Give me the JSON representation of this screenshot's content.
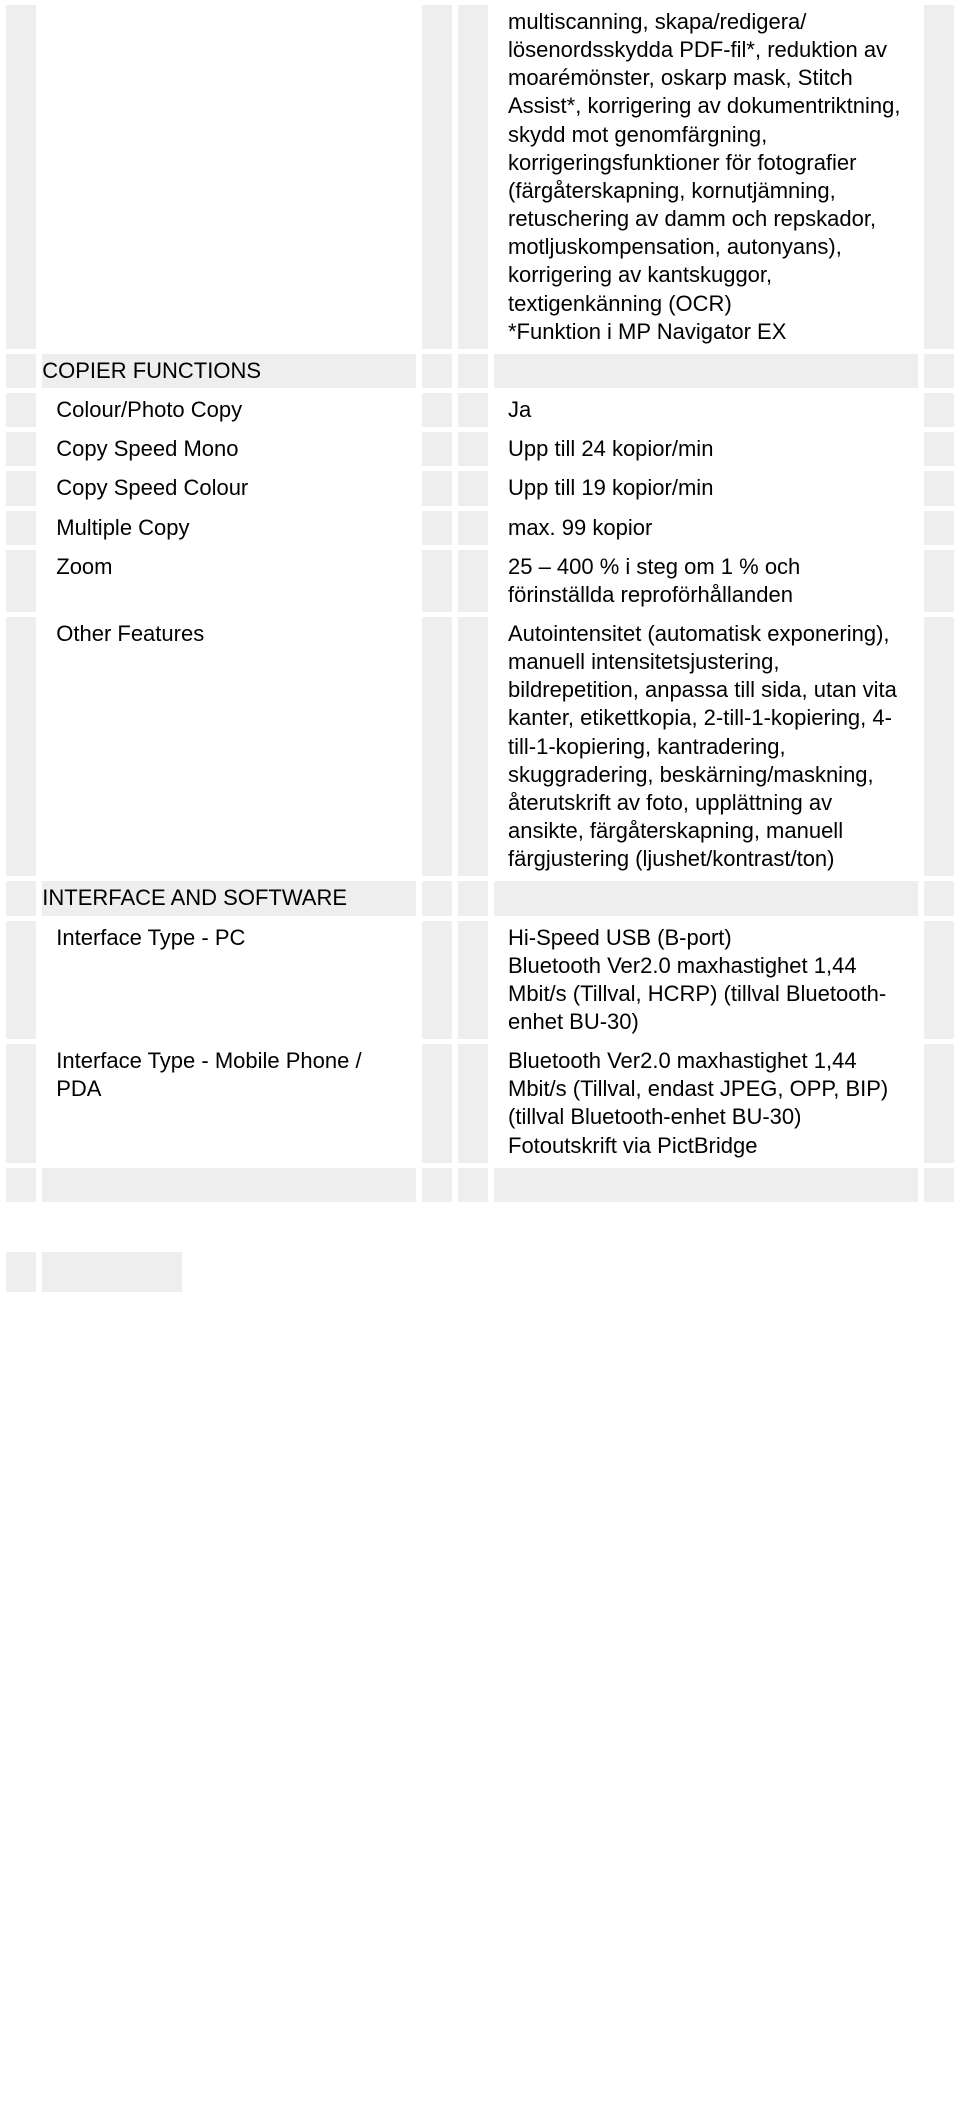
{
  "intro": "multiscanning, skapa/redigera/\nlösenordsskydda PDF-fil*, reduktion av moarémönster, oskarp mask, Stitch Assist*, korrigering av dokumentriktning, skydd mot genomfärgning, korrigeringsfunktioner för fotografier (färgåterskapning, kornutjämning, retuschering av damm och repskador, motljuskompensation, autonyans), korrigering av kantskuggor, textigenkänning (OCR)\n*Funktion i MP Navigator EX",
  "sections": {
    "copier": {
      "title": "COPIER FUNCTIONS",
      "rows": {
        "colourPhotoCopy": {
          "label": "Colour/Photo Copy",
          "value": "Ja"
        },
        "copySpeedMono": {
          "label": "Copy Speed Mono",
          "value": "Upp till 24 kopior/min"
        },
        "copySpeedColour": {
          "label": "Copy Speed Colour",
          "value": "Upp till 19 kopior/min"
        },
        "multipleCopy": {
          "label": "Multiple Copy",
          "value": "max. 99 kopior"
        },
        "zoom": {
          "label": "Zoom",
          "value": "25 – 400 % i steg om 1 % och förinställda reproförhållanden"
        },
        "otherFeatures": {
          "label": "Other Features",
          "value": "Autointensitet (automatisk exponering), manuell intensitetsjustering, bildrepetition, anpassa till sida, utan vita kanter, etikettkopia, 2-till-1-kopiering, 4-till-1-kopiering, kantradering, skuggradering, beskärning/maskning, återutskrift av foto, upplättning av ansikte, färgåterskapning, manuell färgjustering (ljushet/kontrast/ton)"
        }
      }
    },
    "interface": {
      "title": "INTERFACE AND SOFTWARE",
      "rows": {
        "pc": {
          "label": "Interface Type - PC",
          "value": "Hi-Speed USB (B-port)\nBluetooth Ver2.0 maxhastighet 1,44 Mbit/s (Tillval, HCRP) (tillval Bluetooth-enhet BU-30)"
        },
        "mobile": {
          "label": "Interface Type - Mobile Phone / PDA",
          "value": "Bluetooth Ver2.0 maxhastighet 1,44 Mbit/s (Tillval, endast JPEG, OPP, BIP) (tillval Bluetooth-enhet BU-30)\nFotoutskrift via PictBridge"
        }
      }
    }
  }
}
